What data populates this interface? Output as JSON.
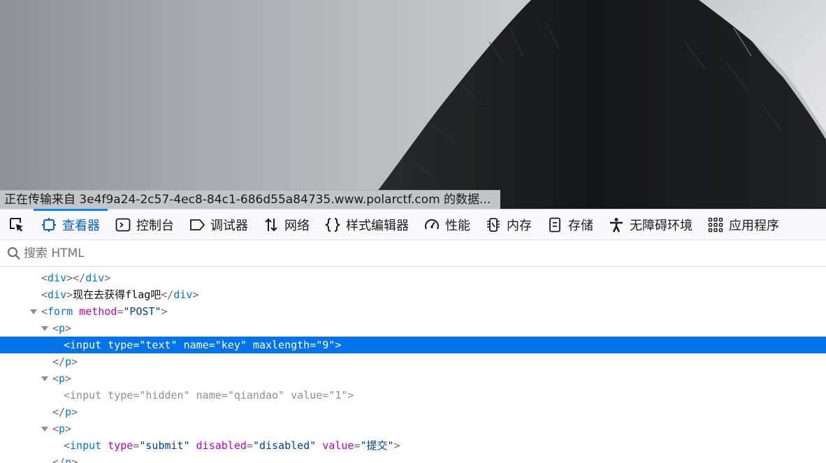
{
  "viewport": {
    "status_text": "正在传输来自 3e4f9a24-2c57-4ec8-84c1-686d55a84735.www.polarctf.com 的数据..."
  },
  "toolbar": {
    "pick_icon": "element-picker-icon",
    "tabs": [
      {
        "label": "查看器",
        "icon": "inspector-icon",
        "selected": true
      },
      {
        "label": "控制台",
        "icon": "console-icon",
        "selected": false
      },
      {
        "label": "调试器",
        "icon": "debugger-icon",
        "selected": false
      },
      {
        "label": "网络",
        "icon": "network-icon",
        "selected": false
      },
      {
        "label": "样式编辑器",
        "icon": "style-editor-icon",
        "selected": false
      },
      {
        "label": "性能",
        "icon": "performance-icon",
        "selected": false
      },
      {
        "label": "内存",
        "icon": "memory-icon",
        "selected": false
      },
      {
        "label": "存储",
        "icon": "storage-icon",
        "selected": false
      },
      {
        "label": "无障碍环境",
        "icon": "accessibility-icon",
        "selected": false
      },
      {
        "label": "应用程序",
        "icon": "application-icon",
        "selected": false
      }
    ]
  },
  "search": {
    "placeholder": "搜索 HTML",
    "value": ""
  },
  "tree": {
    "l1": {
      "open": "<",
      "tag": "div",
      "mid": "></",
      "tag2": "div",
      "close": ">"
    },
    "l2": {
      "open": "<",
      "tag": "div",
      "close": ">",
      "text": "现在去获得flag吧",
      "end_open": "</",
      "tag2": "div",
      "end_close": ">"
    },
    "l3": {
      "open": "<",
      "tag": "form",
      "attr1": "method",
      "eq": "=",
      "val1": "\"POST\"",
      "close": ">"
    },
    "l4": {
      "open": "<",
      "tag": "p",
      "close": ">"
    },
    "l5": {
      "open": "<",
      "tag": "input",
      "attr1": "type",
      "val1": "\"text\"",
      "attr2": "name",
      "val2": "\"key\"",
      "attr3": "maxlength",
      "val3": "\"9\"",
      "close": ">"
    },
    "l6": {
      "open": "</",
      "tag": "p",
      "close": ">"
    },
    "l7": {
      "open": "<",
      "tag": "p",
      "close": ">"
    },
    "l8": {
      "open": "<",
      "tag": "input",
      "attr1": "type",
      "val1": "\"hidden\"",
      "attr2": "name",
      "val2": "\"qiandao\"",
      "attr3": "value",
      "val3": "\"1\"",
      "close": ">"
    },
    "l9": {
      "open": "</",
      "tag": "p",
      "close": ">"
    },
    "l10": {
      "open": "<",
      "tag": "p",
      "close": ">"
    },
    "l11": {
      "open": "<",
      "tag": "input",
      "attr1": "type",
      "val1": "\"submit\"",
      "attr2": "disabled",
      "val2": "\"disabled\"",
      "attr3": "value",
      "val3": "\"提交\"",
      "close": ">"
    },
    "l12": {
      "open": "</",
      "tag": "p",
      "close": ">"
    },
    "eq": "="
  },
  "colors": {
    "accent": "#0a84ff",
    "selected_row": "#0074e8",
    "tag": "#0074e8",
    "attr_name": "#c000c0",
    "attr_value": "#003eaa"
  }
}
